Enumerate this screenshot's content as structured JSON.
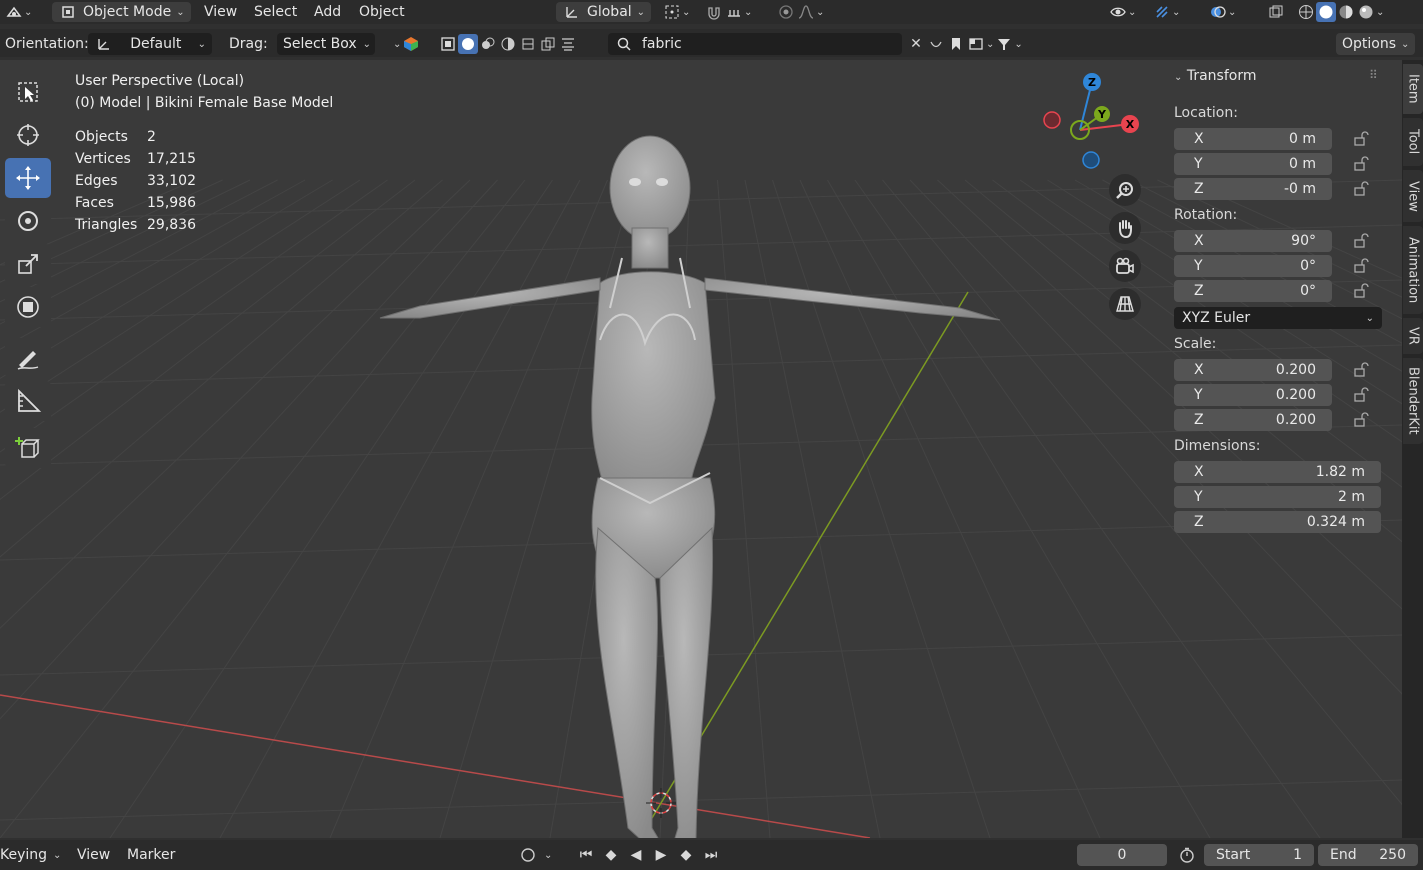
{
  "header": {
    "mode_label": "Object Mode",
    "menu": [
      "View",
      "Select",
      "Add",
      "Object"
    ],
    "transform_orientation": "Global"
  },
  "toolbar": {
    "orientation_label": "Orientation:",
    "orientation_value": "Default",
    "drag_label": "Drag:",
    "drag_value": "Select Box",
    "search_value": "fabric",
    "options_label": "Options"
  },
  "viewport": {
    "perspective": "User Perspective (Local)",
    "object_info": "(0) Model | Bikini Female Base Model",
    "stats": [
      {
        "label": "Objects",
        "value": "2"
      },
      {
        "label": "Vertices",
        "value": "17,215"
      },
      {
        "label": "Edges",
        "value": "33,102"
      },
      {
        "label": "Faces",
        "value": "15,986"
      },
      {
        "label": "Triangles",
        "value": "29,836"
      }
    ],
    "gizmo": {
      "x": "X",
      "y": "Y",
      "z": "Z"
    }
  },
  "npanel": {
    "title": "Transform",
    "location_label": "Location:",
    "location": [
      {
        "axis": "X",
        "value": "0 m"
      },
      {
        "axis": "Y",
        "value": "0 m"
      },
      {
        "axis": "Z",
        "value": "-0 m"
      }
    ],
    "rotation_label": "Rotation:",
    "rotation": [
      {
        "axis": "X",
        "value": "90°"
      },
      {
        "axis": "Y",
        "value": "0°"
      },
      {
        "axis": "Z",
        "value": "0°"
      }
    ],
    "rotation_mode": "XYZ Euler",
    "scale_label": "Scale:",
    "scale": [
      {
        "axis": "X",
        "value": "0.200"
      },
      {
        "axis": "Y",
        "value": "0.200"
      },
      {
        "axis": "Z",
        "value": "0.200"
      }
    ],
    "dimensions_label": "Dimensions:",
    "dimensions": [
      {
        "axis": "X",
        "value": "1.82 m"
      },
      {
        "axis": "Y",
        "value": "2 m"
      },
      {
        "axis": "Z",
        "value": "0.324 m"
      }
    ]
  },
  "sidetabs": [
    "Item",
    "Tool",
    "View",
    "Animation",
    "VR",
    "BlenderKit"
  ],
  "timeline": {
    "menu": [
      "Keying",
      "View",
      "Marker"
    ],
    "current_frame": "0",
    "start_label": "Start",
    "start_value": "1",
    "end_label": "End",
    "end_value": "250"
  },
  "colors": {
    "accent": "#4772b3",
    "axis_x": "#e8444f",
    "axis_y": "#7ca81d",
    "axis_z": "#2f86d8"
  }
}
